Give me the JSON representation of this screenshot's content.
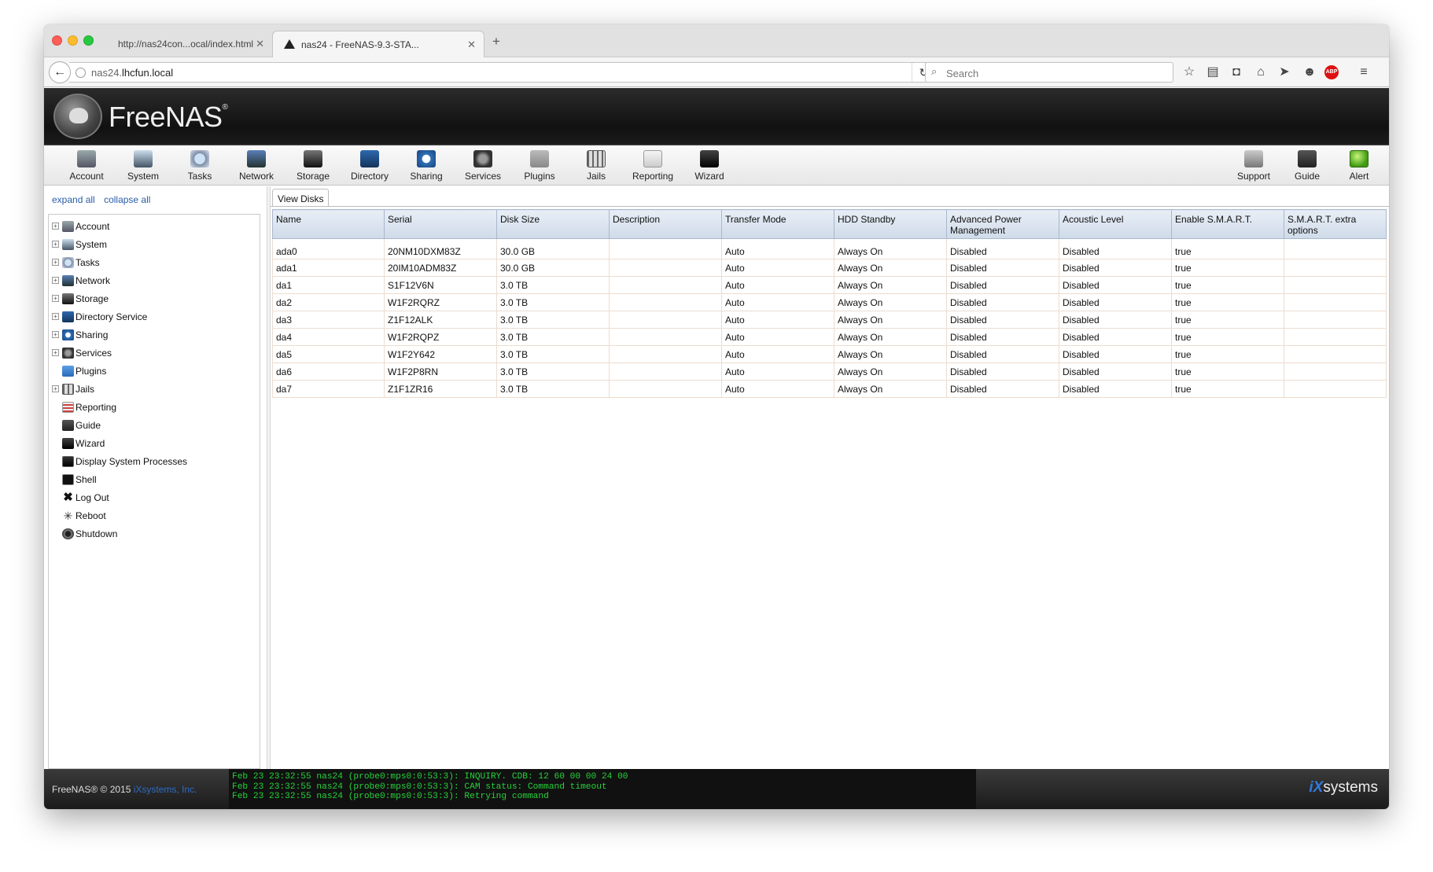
{
  "browser": {
    "tabs": [
      {
        "title": "http://nas24con...ocal/index.html",
        "active": false
      },
      {
        "title": "nas24 - FreeNAS-9.3-STA...",
        "active": true
      }
    ],
    "url_prefix": "nas24.",
    "url_domain": "lhcfun.local",
    "search_placeholder": "Search",
    "toolbar_icons": [
      "bookmark-star-icon",
      "reading-list-icon",
      "pocket-icon",
      "home-icon",
      "send-icon",
      "chat-icon",
      "adblock-icon",
      "menu-icon"
    ],
    "adblock_label": "ABP"
  },
  "app": {
    "name": "FreeNAS",
    "trademark": "®"
  },
  "toolbar": {
    "left": [
      {
        "label": "Account",
        "icon": "account-icon"
      },
      {
        "label": "System",
        "icon": "system-icon"
      },
      {
        "label": "Tasks",
        "icon": "tasks-icon"
      },
      {
        "label": "Network",
        "icon": "network-icon"
      },
      {
        "label": "Storage",
        "icon": "storage-icon"
      },
      {
        "label": "Directory",
        "icon": "directory-icon"
      },
      {
        "label": "Sharing",
        "icon": "sharing-icon"
      },
      {
        "label": "Services",
        "icon": "services-icon"
      },
      {
        "label": "Plugins",
        "icon": "plugins-icon"
      },
      {
        "label": "Jails",
        "icon": "jails-icon"
      },
      {
        "label": "Reporting",
        "icon": "reporting-icon"
      },
      {
        "label": "Wizard",
        "icon": "wizard-icon"
      }
    ],
    "right": [
      {
        "label": "Support",
        "icon": "support-icon"
      },
      {
        "label": "Guide",
        "icon": "guide-icon"
      },
      {
        "label": "Alert",
        "icon": "alert-icon"
      }
    ]
  },
  "sidebar": {
    "expand_all": "expand all",
    "collapse_all": "collapse all",
    "items": [
      {
        "label": "Account",
        "expandable": true,
        "icon": "account-icon"
      },
      {
        "label": "System",
        "expandable": true,
        "icon": "system-icon"
      },
      {
        "label": "Tasks",
        "expandable": true,
        "icon": "tasks-icon"
      },
      {
        "label": "Network",
        "expandable": true,
        "icon": "network-icon"
      },
      {
        "label": "Storage",
        "expandable": true,
        "icon": "storage-icon"
      },
      {
        "label": "Directory Service",
        "expandable": true,
        "icon": "directory-icon"
      },
      {
        "label": "Sharing",
        "expandable": true,
        "icon": "sharing-icon"
      },
      {
        "label": "Services",
        "expandable": true,
        "icon": "services-icon"
      },
      {
        "label": "Plugins",
        "expandable": false,
        "icon": "plugins-icon"
      },
      {
        "label": "Jails",
        "expandable": true,
        "icon": "jails-icon"
      },
      {
        "label": "Reporting",
        "expandable": false,
        "icon": "reporting-icon"
      },
      {
        "label": "Guide",
        "expandable": false,
        "icon": "guide-icon"
      },
      {
        "label": "Wizard",
        "expandable": false,
        "icon": "wizard-icon"
      },
      {
        "label": "Display System Processes",
        "expandable": false,
        "icon": "processes-icon"
      },
      {
        "label": "Shell",
        "expandable": false,
        "icon": "shell-icon"
      },
      {
        "label": "Log Out",
        "expandable": false,
        "icon": "logout-icon"
      },
      {
        "label": "Reboot",
        "expandable": false,
        "icon": "reboot-icon"
      },
      {
        "label": "Shutdown",
        "expandable": false,
        "icon": "shutdown-icon"
      }
    ]
  },
  "content": {
    "tab_label": "View Disks",
    "columns": [
      "Name",
      "Serial",
      "Disk Size",
      "Description",
      "Transfer Mode",
      "HDD Standby",
      "Advanced Power Management",
      "Acoustic Level",
      "Enable S.M.A.R.T.",
      "S.M.A.R.T. extra options"
    ],
    "rows": [
      [
        "ada0",
        "20NM10DXM83Z",
        "30.0 GB",
        "",
        "Auto",
        "Always On",
        "Disabled",
        "Disabled",
        "true",
        ""
      ],
      [
        "ada1",
        "20IM10ADM83Z",
        "30.0 GB",
        "",
        "Auto",
        "Always On",
        "Disabled",
        "Disabled",
        "true",
        ""
      ],
      [
        "da1",
        "S1F12V6N",
        "3.0 TB",
        "",
        "Auto",
        "Always On",
        "Disabled",
        "Disabled",
        "true",
        ""
      ],
      [
        "da2",
        "W1F2RQRZ",
        "3.0 TB",
        "",
        "Auto",
        "Always On",
        "Disabled",
        "Disabled",
        "true",
        ""
      ],
      [
        "da3",
        "Z1F12ALK",
        "3.0 TB",
        "",
        "Auto",
        "Always On",
        "Disabled",
        "Disabled",
        "true",
        ""
      ],
      [
        "da4",
        "W1F2RQPZ",
        "3.0 TB",
        "",
        "Auto",
        "Always On",
        "Disabled",
        "Disabled",
        "true",
        ""
      ],
      [
        "da5",
        "W1F2Y642",
        "3.0 TB",
        "",
        "Auto",
        "Always On",
        "Disabled",
        "Disabled",
        "true",
        ""
      ],
      [
        "da6",
        "W1F2P8RN",
        "3.0 TB",
        "",
        "Auto",
        "Always On",
        "Disabled",
        "Disabled",
        "true",
        ""
      ],
      [
        "da7",
        "Z1F1ZR16",
        "3.0 TB",
        "",
        "Auto",
        "Always On",
        "Disabled",
        "Disabled",
        "true",
        ""
      ]
    ]
  },
  "footer": {
    "copyright_prefix": "FreeNAS® © 2015 ",
    "copyright_company": "iXsystems, Inc.",
    "console_lines": [
      "Feb 23 23:32:55 nas24 (probe0:mps0:0:53:3): INQUIRY. CDB: 12 60 00 00 24 00",
      "Feb 23 23:32:55 nas24 (probe0:mps0:0:53:3): CAM status: Command timeout",
      "Feb 23 23:32:55 nas24 (probe0:mps0:0:53:3): Retrying command"
    ],
    "vendor_mark": "iX",
    "vendor_text": "systems"
  },
  "colors": {
    "console_text": "#27d23b",
    "link": "#2a5caa",
    "header_bg": "#1a1a1a"
  }
}
